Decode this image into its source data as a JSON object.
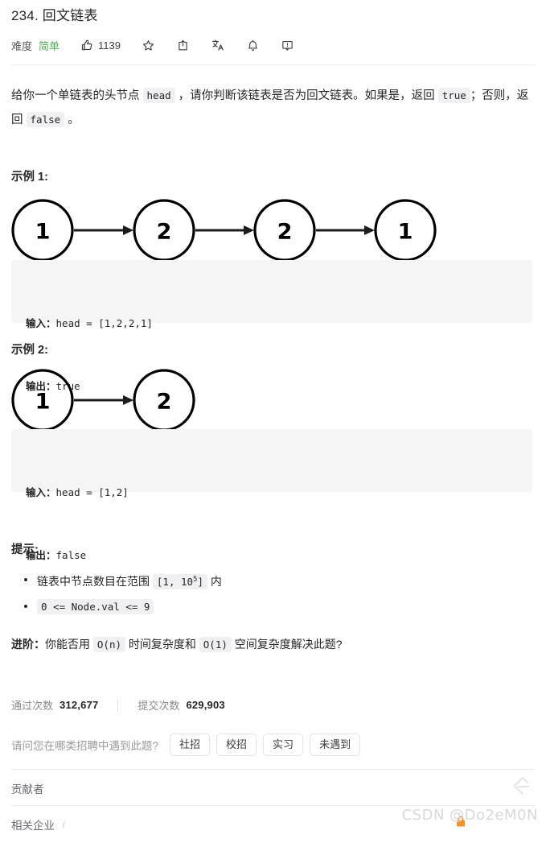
{
  "problem": {
    "title": "234. 回文链表",
    "difficulty_label": "难度",
    "difficulty": "简单",
    "difficulty_color": "#4caf50",
    "likes": "1139"
  },
  "actions": [
    {
      "name": "thumbs-up-icon",
      "label": "1139"
    },
    {
      "name": "star-icon",
      "label": ""
    },
    {
      "name": "share-icon",
      "label": ""
    },
    {
      "name": "translate-icon",
      "label": ""
    },
    {
      "name": "bell-icon",
      "label": ""
    },
    {
      "name": "feedback-icon",
      "label": ""
    }
  ],
  "description": {
    "part1": "给你一个单链表的头节点 ",
    "code1": "head",
    "part2": " ，请你判断该链表是否为回文链表。如果是，返回 ",
    "code2": "true",
    "part3": "；否则，返回 ",
    "code3": "false",
    "part4": " 。"
  },
  "examples": [
    {
      "heading": "示例 1:",
      "diagram": {
        "nodes": [
          "1",
          "2",
          "2",
          "1"
        ]
      },
      "input_label": "输入：",
      "input_value": "head = [1,2,2,1]",
      "output_label": "输出：",
      "output_value": "true"
    },
    {
      "heading": "示例 2:",
      "diagram": {
        "nodes": [
          "1",
          "2"
        ]
      },
      "input_label": "输入：",
      "input_value": "head = [1,2]",
      "output_label": "输出：",
      "output_value": "false"
    }
  ],
  "hints": {
    "heading": "提示:",
    "items": [
      {
        "text_before": "链表中节点数目在范围 ",
        "code_a": "[1, 10",
        "code_sup": "5",
        "code_b": "]",
        "text_after": " 内"
      },
      {
        "code_only": "0 <= Node.val <= 9"
      }
    ]
  },
  "advanced": {
    "lead": "进阶：",
    "part1": "你能否用 ",
    "code1": "O(n)",
    "part2": " 时间复杂度和 ",
    "code2": "O(1)",
    "part3": " 空间复杂度解决此题?"
  },
  "stats": {
    "accepted_label": "通过次数",
    "accepted_value": "312,677",
    "submissions_label": "提交次数",
    "submissions_value": "629,903"
  },
  "survey": {
    "question": "请问您在哪类招聘中遇到此题?",
    "options": [
      "社招",
      "校招",
      "实习",
      "未遇到"
    ]
  },
  "footer": {
    "contributors_label": "贡献者",
    "companies_label": "相关企业",
    "companies_info": "i"
  },
  "watermark": "CSDN @Do2eM0N"
}
